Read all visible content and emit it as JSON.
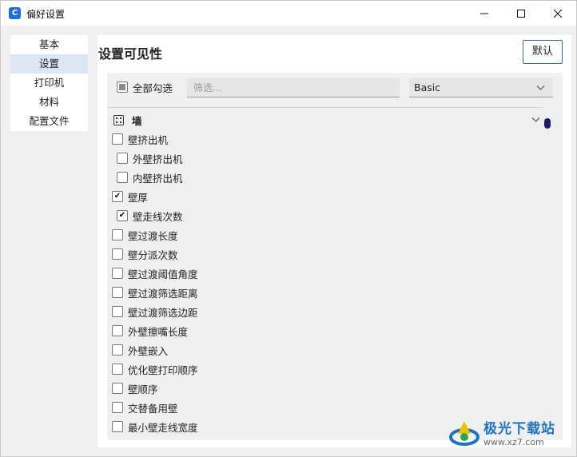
{
  "window": {
    "title": "偏好设置",
    "app_icon_glyph": "C",
    "controls": [
      "minimize-icon",
      "maximize-icon",
      "close-icon"
    ]
  },
  "sidebar": {
    "items": [
      {
        "label": "基本",
        "active": false
      },
      {
        "label": "设置",
        "active": true
      },
      {
        "label": "打印机",
        "active": false
      },
      {
        "label": "材料",
        "active": false
      },
      {
        "label": "配置文件",
        "active": false
      }
    ]
  },
  "panel": {
    "title": "设置可见性",
    "default_button": "默认",
    "select_all_label": "全部勾选",
    "select_all_state": "partial",
    "filter_placeholder": "筛选...",
    "level_value": "Basic",
    "category": {
      "icon": "grid-icon",
      "label": "墙"
    },
    "settings": [
      {
        "label": "壁挤出机",
        "checked": false,
        "indent": false
      },
      {
        "label": "外壁挤出机",
        "checked": false,
        "indent": true
      },
      {
        "label": "内壁挤出机",
        "checked": false,
        "indent": true
      },
      {
        "label": "壁厚",
        "checked": true,
        "indent": false
      },
      {
        "label": "壁走线次数",
        "checked": true,
        "indent": true
      },
      {
        "label": "壁过渡长度",
        "checked": false,
        "indent": false
      },
      {
        "label": "壁分派次数",
        "checked": false,
        "indent": false
      },
      {
        "label": "壁过渡阈值角度",
        "checked": false,
        "indent": false
      },
      {
        "label": "壁过渡筛选距离",
        "checked": false,
        "indent": false
      },
      {
        "label": "壁过渡筛选边距",
        "checked": false,
        "indent": false
      },
      {
        "label": "外壁擦嘴长度",
        "checked": false,
        "indent": false
      },
      {
        "label": "外壁嵌入",
        "checked": false,
        "indent": false
      },
      {
        "label": "优化壁打印顺序",
        "checked": false,
        "indent": false
      },
      {
        "label": "壁顺序",
        "checked": false,
        "indent": false
      },
      {
        "label": "交替备用壁",
        "checked": false,
        "indent": false
      },
      {
        "label": "最小壁走线宽度",
        "checked": false,
        "indent": false
      }
    ]
  },
  "watermark": {
    "brand": "极光下载站",
    "url": "www.xz7.com"
  },
  "colors": {
    "accent": "#2f66c8",
    "active_sidebar": "#dce7f6",
    "scroll_thumb": "#1a1a6e"
  }
}
